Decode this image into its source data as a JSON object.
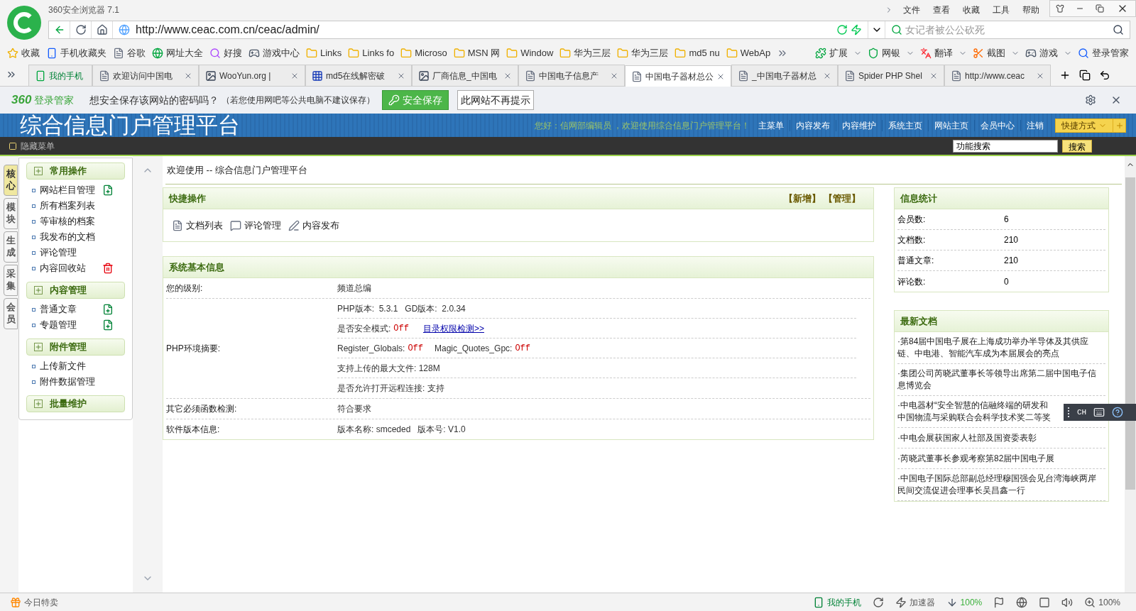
{
  "browser": {
    "app_title": "360安全浏览器 7.1",
    "menu": [
      "文件",
      "查看",
      "收藏",
      "工具",
      "帮助"
    ],
    "address": "http://www.ceac.com.cn/ceac/admin/",
    "search_placeholder": "女记者被公公砍死",
    "bookmarks": [
      "收藏",
      "手机收藏夹",
      "谷歌",
      "网址大全",
      "好搜",
      "游戏中心",
      "Links",
      "Links fo",
      "Microso",
      "MSN 网",
      "Window",
      "华为三层",
      "华为三层",
      "md5 nu",
      "WebAp"
    ],
    "tools": [
      "扩展",
      "网银",
      "翻译",
      "截图",
      "游戏",
      "登录管家"
    ],
    "tabs": [
      {
        "label": "我的手机",
        "selected": false
      },
      {
        "label": "欢迎访问中国电",
        "selected": false
      },
      {
        "label": "WooYun.org |",
        "selected": false
      },
      {
        "label": "md5在线解密破",
        "selected": false
      },
      {
        "label": "厂商信息_中国电",
        "selected": false
      },
      {
        "label": "中国电子信息产",
        "selected": false
      },
      {
        "label": "中国电子器材总公",
        "selected": true
      },
      {
        "label": "_中国电子器材总",
        "selected": false
      },
      {
        "label": "Spider PHP Shel",
        "selected": false
      },
      {
        "label": "http://www.ceac",
        "selected": false
      }
    ],
    "password_bar": {
      "brand": "360",
      "brand_suffix": "登录管家",
      "prompt": "想安全保存该网站的密码吗？",
      "note": "（若您使用网吧等公共电脑不建议保存）",
      "save_button": "安全保存",
      "never_button": "此网站不再提示"
    }
  },
  "page": {
    "title": "综合信息门户管理平台",
    "greeting": "您好：信网部编辑员 ，欢迎使用综合信息门户管理平台！",
    "nav": [
      "主菜单",
      "内容发布",
      "内容维护",
      "系统主页",
      "网站主页",
      "会员中心",
      "注销"
    ],
    "shortcut": "快捷方式",
    "hide_menu": "隐藏菜单",
    "search_value": "功能搜索",
    "search_button": "搜索",
    "side_tabs": [
      {
        "label": "核心",
        "selected": true
      },
      {
        "label": "模块",
        "selected": false
      },
      {
        "label": "生成",
        "selected": false
      },
      {
        "label": "采集",
        "selected": false
      },
      {
        "label": "会员",
        "selected": false
      }
    ],
    "sidebar_groups": [
      {
        "title": "常用操作",
        "items": [
          {
            "label": "网站栏目管理",
            "kind": "add"
          },
          {
            "label": "所有档案列表",
            "kind": "plain"
          },
          {
            "label": "等审核的档案",
            "kind": "plain"
          },
          {
            "label": "我发布的文档",
            "kind": "plain"
          },
          {
            "label": "评论管理",
            "kind": "plain"
          },
          {
            "label": "内容回收站",
            "kind": "trash"
          }
        ]
      },
      {
        "title": "内容管理",
        "items": [
          {
            "label": "普通文章",
            "kind": "add"
          },
          {
            "label": "专题管理",
            "kind": "add"
          }
        ]
      },
      {
        "title": "附件管理",
        "items": [
          {
            "label": "上传新文件",
            "kind": "plain"
          },
          {
            "label": "附件数据管理",
            "kind": "plain"
          }
        ]
      },
      {
        "title": "批量维护"
      }
    ],
    "welcome": "欢迎使用 -- 综合信息门户管理平台",
    "quick": {
      "title": "快捷操作",
      "actions": [
        "【新增】",
        "【管理】"
      ],
      "links": [
        "文档列表",
        "评论管理",
        "内容发布"
      ]
    },
    "system": {
      "title": "系统基本信息",
      "rows": [
        {
          "label": "您的级别:",
          "lines": [
            [
              {
                "kind": "text",
                "text": "频道总编"
              }
            ]
          ]
        },
        {
          "label": "PHP环境摘要:",
          "lines": [
            [
              {
                "kind": "text",
                "text": "PHP版本:  5.3.1   GD版本:  2.0.34"
              }
            ],
            [
              {
                "kind": "text",
                "text": "是否安全模式:"
              },
              {
                "kind": "off",
                "text": "Off"
              },
              {
                "kind": "link",
                "text": "目录权限检测>>"
              }
            ],
            [
              {
                "kind": "text",
                "text": "Register_Globals:"
              },
              {
                "kind": "off",
                "text": "Off"
              },
              {
                "kind": "text",
                "text": "Magic_Quotes_Gpc:"
              },
              {
                "kind": "off",
                "text": "Off"
              }
            ],
            [
              {
                "kind": "text",
                "text": "支持上传的最大文件: 128M"
              }
            ],
            [
              {
                "kind": "text",
                "text": "是否允许打开远程连接: 支持"
              }
            ]
          ]
        },
        {
          "label": "其它必须函数检测:",
          "lines": [
            [
              {
                "kind": "text",
                "text": "符合要求"
              }
            ]
          ]
        },
        {
          "label": "软件版本信息:",
          "lines": [
            [
              {
                "kind": "text",
                "text": "版本名称: smceded   版本号: V1.0"
              }
            ]
          ]
        }
      ]
    },
    "stats": {
      "title": "信息统计",
      "rows": [
        {
          "label": "会员数:",
          "value": "6"
        },
        {
          "label": "文档数:",
          "value": "210"
        },
        {
          "label": "普通文章:",
          "value": "210"
        },
        {
          "label": "评论数:",
          "value": "0"
        }
      ]
    },
    "news": {
      "title": "最新文档",
      "items": [
        {
          "lines": [
            "·第84届中国电子展在上海成功举办半导体及其供应",
            "链、中电港、智能汽车成为本届展会的亮点"
          ]
        },
        {
          "lines": [
            "·集团公司芮晓武董事长等领导出席第二届中国电子信",
            "息博览会"
          ]
        },
        {
          "lines": [
            "·中电器材“安全智慧的信融终端的研发和",
            "中国物流与采购联合会科学技术奖二等奖"
          ]
        },
        {
          "lines": [
            "·中电会展获国家人社部及国资委表彰"
          ]
        },
        {
          "lines": [
            "·芮晓武董事长参观考察第82届中国电子展"
          ]
        },
        {
          "lines": [
            "·中国电子国际总部副总经理穆国强会见台湾海峡两岸",
            "民间交流促进会理事长吴昌鑫一行"
          ]
        }
      ]
    }
  },
  "ime": {
    "label": "CH"
  },
  "status_bar": {
    "left": "今日特卖",
    "phone": "我的手机",
    "accelerator": "加速器",
    "download": "100%",
    "zoom": "100%"
  }
}
